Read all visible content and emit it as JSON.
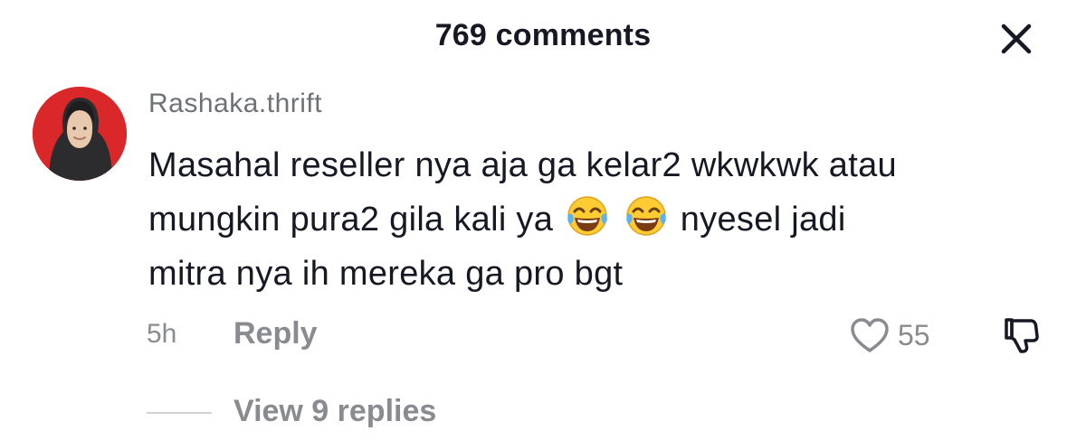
{
  "header": {
    "title": "769 comments",
    "close_icon": "close-icon"
  },
  "comment": {
    "username": "Rashaka.thrift",
    "avatar": "avatar-woman-in-hijab",
    "lines": [
      "Masahal reseller nya aja ga kelar2 wkwkwk atau",
      "mungkin pura2 gila kali ya",
      "nyesel jadi",
      "mitra nya ih mereka ga pro bgt"
    ],
    "emojis": [
      "face-with-tears-of-joy",
      "face-with-tears-of-joy"
    ],
    "time": "5h",
    "reply_label": "Reply",
    "like_count": "55",
    "like_icon": "heart-outline-icon",
    "dislike_icon": "thumbs-down-icon",
    "view_replies_label": "View 9 replies"
  },
  "colors": {
    "text_primary": "#161823",
    "text_secondary": "#8a8b91",
    "avatar_bg": "#d9272a"
  }
}
